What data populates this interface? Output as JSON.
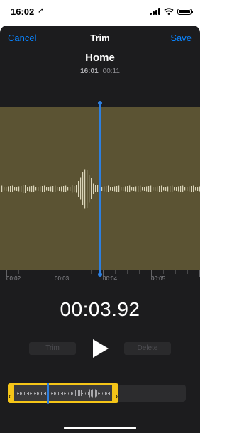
{
  "status_bar": {
    "time": "16:02",
    "location_icon": "location-arrow-icon",
    "signal_icon": "cellular-signal-icon",
    "wifi_icon": "wifi-icon",
    "battery_icon": "battery-icon"
  },
  "nav": {
    "cancel_label": "Cancel",
    "title": "Trim",
    "save_label": "Save"
  },
  "recording": {
    "name": "Home",
    "date": "16:01",
    "duration": "00:11"
  },
  "ruler": {
    "labels": [
      "00:02",
      "00:03",
      "00:04",
      "00:05"
    ]
  },
  "playback": {
    "current_time": "00:03.92",
    "trim_label": "Trim",
    "delete_label": "Delete",
    "play_icon": "play-icon"
  },
  "colors": {
    "accent": "#0a84ff",
    "playhead": "#2d7fe0",
    "trim_handle": "#f5c518",
    "waveform_bg": "#5b5333",
    "sheet_bg": "#1c1c1e"
  }
}
